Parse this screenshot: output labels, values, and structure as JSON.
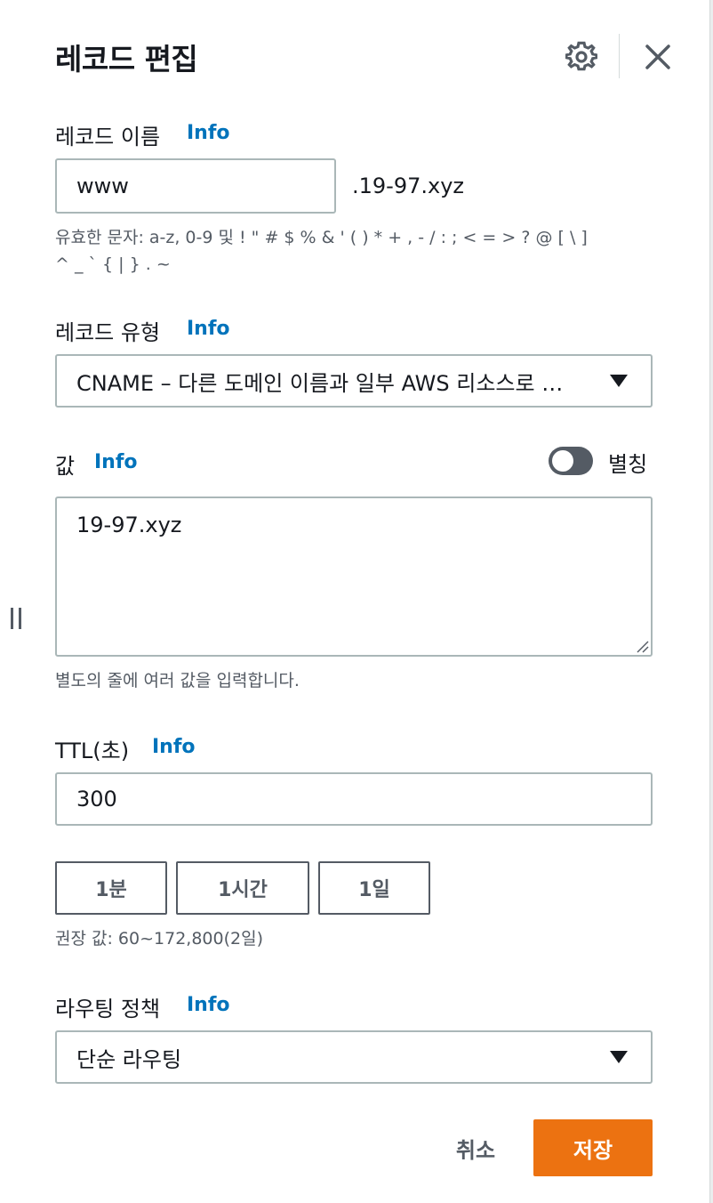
{
  "header": {
    "title": "레코드 편집",
    "settings_icon": "gear-icon",
    "close_icon": "close-icon"
  },
  "record_name": {
    "label": "레코드 이름",
    "info": "Info",
    "value": "www",
    "suffix": ".19-97.xyz",
    "hint_line1": "유효한 문자: a-z, 0-9 및 ! \" # $ % & ' ( ) * + , - / : ; < = > ? @ [ \\ ]",
    "hint_line2": "^ _ ` { | } . ~"
  },
  "record_type": {
    "label": "레코드 유형",
    "info": "Info",
    "selected": "CNAME – 다른 도메인 이름과 일부 AWS 리소스로 …"
  },
  "value_field": {
    "label": "값",
    "info": "Info",
    "alias_label": "별칭",
    "alias_enabled": false,
    "value": "19-97.xyz",
    "hint": "별도의 줄에 여러 값을 입력합니다."
  },
  "ttl": {
    "label": "TTL(초)",
    "info": "Info",
    "value": "300",
    "presets": [
      "1분",
      "1시간",
      "1일"
    ],
    "hint": "권장 값: 60~172,800(2일)"
  },
  "routing_policy": {
    "label": "라우팅 정책",
    "info": "Info",
    "selected": "단순 라우팅"
  },
  "footer": {
    "cancel_label": "취소",
    "save_label": "저장"
  },
  "colors": {
    "primary_button": "#ec7211",
    "link": "#0073bb",
    "text": "#16191f",
    "muted": "#545b64",
    "border": "#aab7b8"
  }
}
